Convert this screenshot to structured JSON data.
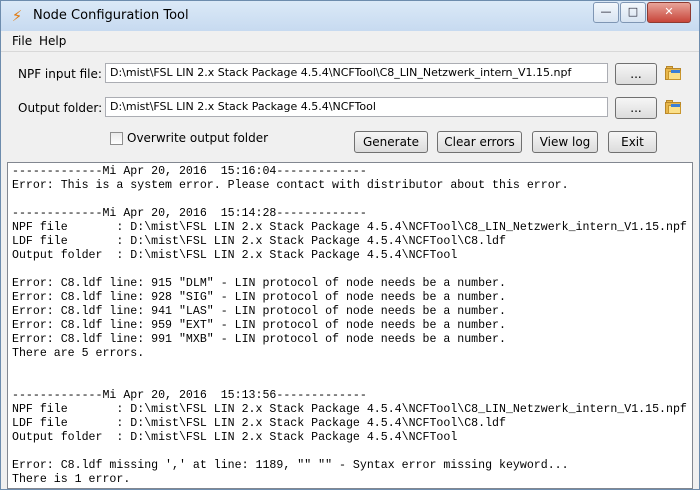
{
  "window": {
    "title": "Node Configuration Tool",
    "icon": "app-icon",
    "controls": [
      "min",
      "max",
      "close"
    ]
  },
  "menu": {
    "items": [
      "File",
      "Help"
    ]
  },
  "form": {
    "npf_label": "NPF input file:",
    "npf_value": "D:\\mist\\FSL LIN 2.x Stack Package 4.5.4\\NCFTool\\C8_LIN_Netzwerk_intern_V1.15.npf",
    "output_label": "Output folder:",
    "output_value": "D:\\mist\\FSL LIN 2.x Stack Package 4.5.4\\NCFTool",
    "browse_label": "...",
    "overwrite_label": "Overwrite output folder",
    "overwrite_checked": false
  },
  "actions": {
    "generate": "Generate",
    "clear_errors": "Clear errors",
    "view_log": "View log",
    "exit": "Exit"
  },
  "log_lines": [
    "-------------Mi Apr 20, 2016  15:16:04-------------",
    "Error: This is a system error. Please contact with distributor about this error.",
    "",
    "-------------Mi Apr 20, 2016  15:14:28-------------",
    "NPF file       : D:\\mist\\FSL LIN 2.x Stack Package 4.5.4\\NCFTool\\C8_LIN_Netzwerk_intern_V1.15.npf",
    "LDF file       : D:\\mist\\FSL LIN 2.x Stack Package 4.5.4\\NCFTool\\C8.ldf",
    "Output folder  : D:\\mist\\FSL LIN 2.x Stack Package 4.5.4\\NCFTool",
    "",
    "Error: C8.ldf line: 915 \"DLM\" - LIN protocol of node needs be a number.",
    "Error: C8.ldf line: 928 \"SIG\" - LIN protocol of node needs be a number.",
    "Error: C8.ldf line: 941 \"LAS\" - LIN protocol of node needs be a number.",
    "Error: C8.ldf line: 959 \"EXT\" - LIN protocol of node needs be a number.",
    "Error: C8.ldf line: 991 \"MXB\" - LIN protocol of node needs be a number.",
    "There are 5 errors.",
    "",
    "",
    "-------------Mi Apr 20, 2016  15:13:56-------------",
    "NPF file       : D:\\mist\\FSL LIN 2.x Stack Package 4.5.4\\NCFTool\\C8_LIN_Netzwerk_intern_V1.15.npf",
    "LDF file       : D:\\mist\\FSL LIN 2.x Stack Package 4.5.4\\NCFTool\\C8.ldf",
    "Output folder  : D:\\mist\\FSL LIN 2.x Stack Package 4.5.4\\NCFTool",
    "",
    "Error: C8.ldf missing ',' at line: 1189, \"\" \"\" - Syntax error missing keyword...",
    "There is 1 error."
  ]
}
